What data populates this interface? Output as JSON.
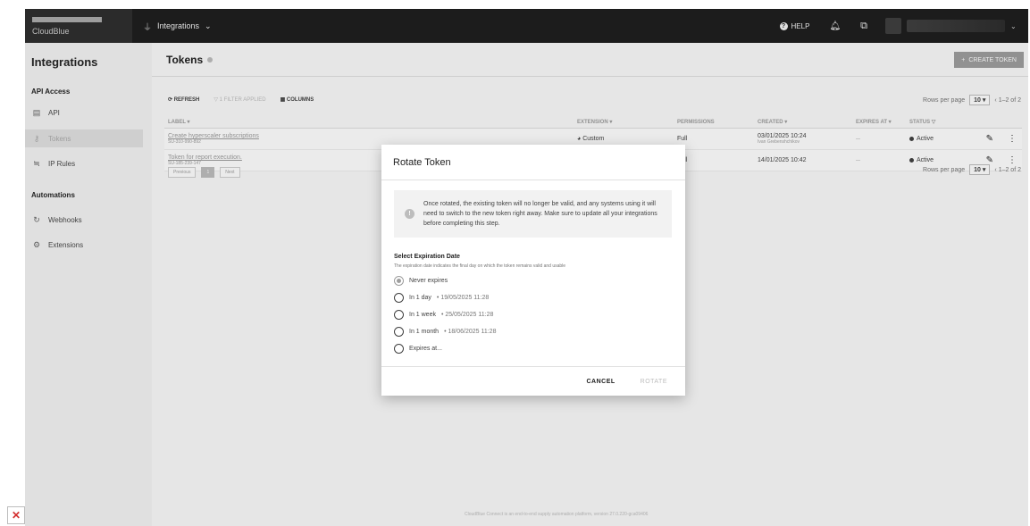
{
  "header": {
    "brand": "CloudBlue",
    "module": "Integrations",
    "help": "HELP"
  },
  "sidebar": {
    "title": "Integrations",
    "sections": [
      {
        "title": "API Access",
        "items": [
          {
            "label": "API"
          },
          {
            "label": "Tokens"
          },
          {
            "label": "IP Rules"
          }
        ]
      },
      {
        "title": "Automations",
        "items": [
          {
            "label": "Webhooks"
          },
          {
            "label": "Extensions"
          }
        ]
      }
    ]
  },
  "page": {
    "title": "Tokens",
    "create_button": "CREATE TOKEN",
    "toolbar": {
      "refresh": "REFRESH",
      "filter": "1 FILTER APPLIED",
      "columns": "COLUMNS"
    },
    "rows_per_page_label": "Rows per page",
    "rows_per_page_value": "10",
    "range": "1–2 of 2",
    "columns": {
      "label": "LABEL",
      "extension": "EXTENSION",
      "permissions": "PERMISSIONS",
      "created": "CREATED",
      "expires": "EXPIRES AT",
      "status": "STATUS"
    },
    "rows": [
      {
        "label": "Create hyperscaler subscriptions",
        "id": "SU-310-990-892",
        "extension": "Custom",
        "permissions": "Full",
        "created": "03/01/2025 10:24",
        "created_by": "Ivan Grebenshchikov",
        "expires": "—",
        "status": "Active"
      },
      {
        "label": "Token for report execution.",
        "id": "SU-185-239-147",
        "extension": "",
        "permissions": "Full",
        "created": "14/01/2025 10:42",
        "created_by": "",
        "expires": "—",
        "status": "Active"
      }
    ],
    "pager": {
      "prev": "Previous",
      "current": "1",
      "next": "Next"
    },
    "footer": "CloudBlue Connect is an end-to-end supply automation platform, version 27.0.220-gca09406"
  },
  "dialog": {
    "title": "Rotate Token",
    "info": "Once rotated, the existing token will no longer be valid, and any systems using it will need to switch to the new token right away. Make sure to update all your integrations before completing this step.",
    "select_title": "Select Expiration Date",
    "select_subtitle": "The expiration date indicates the final day on which the token remains valid and usable",
    "options": [
      {
        "label": "Never expires",
        "date": ""
      },
      {
        "label": "In 1 day",
        "date": "19/05/2025 11:28"
      },
      {
        "label": "In 1 week",
        "date": "25/05/2025 11:28"
      },
      {
        "label": "In 1 month",
        "date": "18/06/2025 11:28"
      },
      {
        "label": "Expires at...",
        "date": ""
      }
    ],
    "selected_option": "Never expires",
    "cancel": "CANCEL",
    "rotate": "ROTATE"
  }
}
